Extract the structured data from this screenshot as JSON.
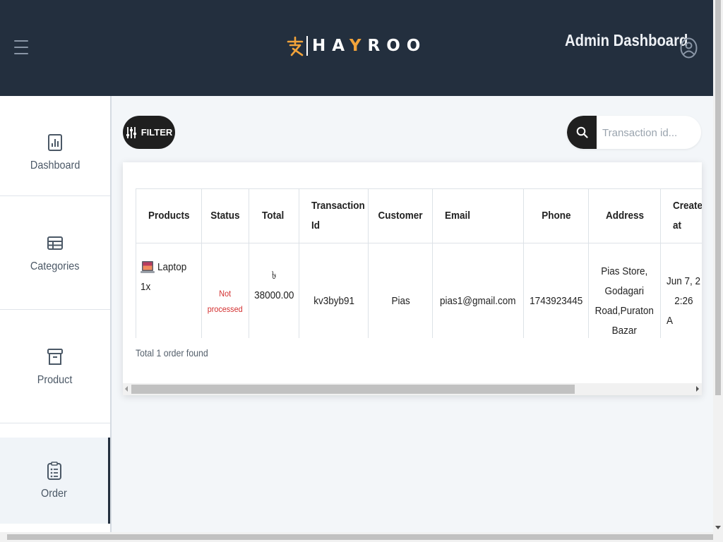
{
  "header": {
    "logo_text_a": "HA",
    "logo_text_y": "Y",
    "logo_text_b": "ROO",
    "title": "Admin Dashboard"
  },
  "sidebar": {
    "items": [
      {
        "label": "Dashboard",
        "icon": "bar-chart-icon"
      },
      {
        "label": "Categories",
        "icon": "table-icon"
      },
      {
        "label": "Product",
        "icon": "archive-icon"
      },
      {
        "label": "Order",
        "icon": "clipboard-list-icon",
        "active": true
      }
    ]
  },
  "toolbar": {
    "filter_label": "FILTER",
    "search_placeholder": "Transaction id..."
  },
  "orders_table": {
    "columns": [
      "Products",
      "Status",
      "Total",
      "Transaction Id",
      "Customer",
      "Email",
      "Phone",
      "Address",
      "Created at"
    ],
    "rows": [
      {
        "product": "Laptop",
        "quantity": "1x",
        "status_line1": "Not",
        "status_line2": "processed",
        "total": "৳ 38000.00",
        "transaction_id": "kv3byb91",
        "customer": "Pias",
        "email": "pias1@gmail.com",
        "phone": "1743923445",
        "address_lines": [
          "Pias Store,",
          "Godagari",
          "Road,Puraton",
          "Bazar"
        ],
        "created_line1": "Jun 7, 2",
        "created_line2": "2:26 A"
      }
    ],
    "total_text": "Total 1 order found"
  },
  "colors": {
    "header_bg": "#232f3e",
    "accent": "#f2a33a",
    "status_not_processed": "#d32f2f",
    "button_dark": "#1f1f1f"
  }
}
